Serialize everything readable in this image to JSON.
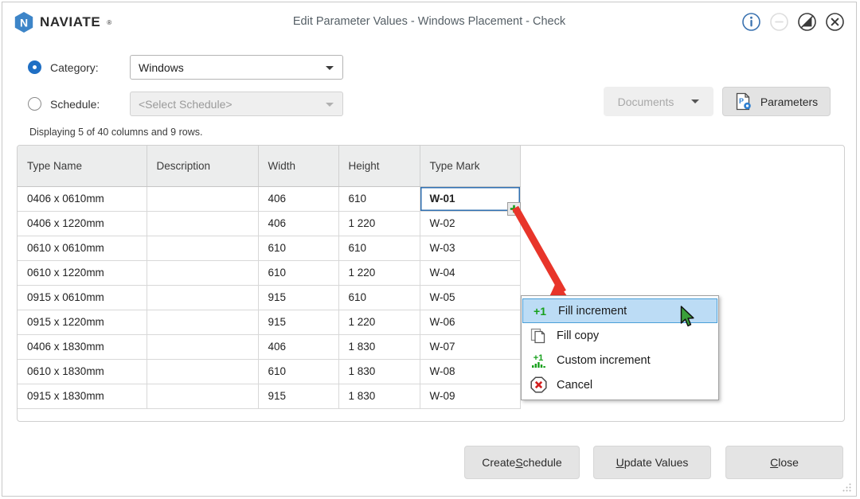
{
  "app": {
    "brand": "NAVIATE",
    "brand_mark": "®",
    "brand_color": "#3d85c8",
    "logo_icon": "naviate-hexagon-logo"
  },
  "titlebar": {
    "title": "Edit Parameter Values - Windows Placement  - Check",
    "controls": [
      {
        "name": "info-icon",
        "glyph": "i",
        "color": "#3a72b0",
        "enabled": true
      },
      {
        "name": "minimize-icon",
        "glyph": "−",
        "color": "#d8d8d8",
        "enabled": false
      },
      {
        "name": "block-icon",
        "glyph": "⃠",
        "color": "#3a3a3a",
        "enabled": true
      },
      {
        "name": "close-icon",
        "glyph": "×",
        "color": "#3a3a3a",
        "enabled": true
      }
    ]
  },
  "selector": {
    "category": {
      "label": "Category:",
      "selected": true,
      "value": "Windows"
    },
    "schedule": {
      "label": "Schedule:",
      "selected": false,
      "value": "<Select Schedule>",
      "disabled": true
    },
    "status_text": "Displaying 5 of 40 columns and 9 rows."
  },
  "toolbar": {
    "documents_label": "Documents",
    "documents_enabled": false,
    "parameters_label": "Parameters",
    "parameters_icon": "document-gear-icon"
  },
  "grid": {
    "columns": [
      "Type Name",
      "Description",
      "Width",
      "Height",
      "Type Mark"
    ],
    "rows": [
      {
        "type_name": "0406 x 0610mm",
        "description": "",
        "width": "406",
        "height": "610",
        "type_mark": "W-01"
      },
      {
        "type_name": "0406 x 1220mm",
        "description": "",
        "width": "406",
        "height": "1 220",
        "type_mark": "W-02"
      },
      {
        "type_name": "0610 x 0610mm",
        "description": "",
        "width": "610",
        "height": "610",
        "type_mark": "W-03"
      },
      {
        "type_name": "0610 x 1220mm",
        "description": "",
        "width": "610",
        "height": "1 220",
        "type_mark": "W-04"
      },
      {
        "type_name": "0915 x 0610mm",
        "description": "",
        "width": "915",
        "height": "610",
        "type_mark": "W-05"
      },
      {
        "type_name": "0915 x 1220mm",
        "description": "",
        "width": "915",
        "height": "1 220",
        "type_mark": "W-06"
      },
      {
        "type_name": "0406 x 1830mm",
        "description": "",
        "width": "406",
        "height": "1 830",
        "type_mark": "W-07"
      },
      {
        "type_name": "0610 x 1830mm",
        "description": "",
        "width": "610",
        "height": "1 830",
        "type_mark": "W-08"
      },
      {
        "type_name": "0915 x 1830mm",
        "description": "",
        "width": "915",
        "height": "1 830",
        "type_mark": "W-09"
      }
    ],
    "selected_cell": {
      "row": 0,
      "column": "Type Mark",
      "value": "W-01"
    },
    "selection_color": "#bcd6ef",
    "fill_handle_icon": "green-plus-icon"
  },
  "context_menu": {
    "items": [
      {
        "label": "Fill increment",
        "icon": "plus-one-icon",
        "highlighted": true
      },
      {
        "label": "Fill copy",
        "icon": "copy-pages-icon",
        "highlighted": false
      },
      {
        "label": "Custom increment",
        "icon": "plus-one-bars-icon",
        "highlighted": false
      },
      {
        "label": "Cancel",
        "icon": "red-x-octagon-icon",
        "highlighted": false
      }
    ],
    "highlight_color": "#bcdcf5"
  },
  "annotation": {
    "arrow_color": "#e8352a",
    "from": "fill-handle",
    "to": "Fill increment"
  },
  "footer": {
    "buttons": [
      {
        "name": "create-schedule-button",
        "before": "Create ",
        "mnemonic": "S",
        "after": "chedule"
      },
      {
        "name": "update-values-button",
        "before": "",
        "mnemonic": "U",
        "after": "pdate Values"
      },
      {
        "name": "close-button",
        "before": "",
        "mnemonic": "C",
        "after": "lose"
      }
    ]
  }
}
